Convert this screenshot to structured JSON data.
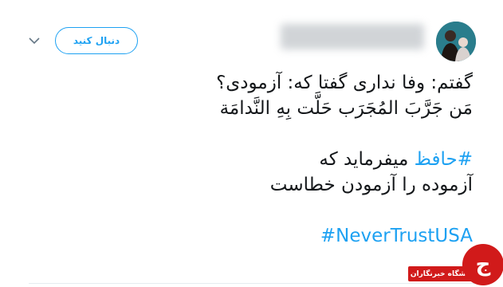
{
  "header": {
    "follow_label": "دنبال کنید"
  },
  "tweet": {
    "line1": "گفتم: وفا نداری گفتا که: آزمودی؟",
    "line2": "مَن جَرَّبَ المُجَرَب حَلَّت بِهِ النَّدامَة",
    "line3_hashtag": "#حافظ",
    "line3_rest": " میفرماید که",
    "line4": "آزموده را آزمودن خطاست",
    "hashtag_en": "#NeverTrustUSA"
  },
  "watermark": {
    "text": "باشگاه خبرنگاران",
    "logo_letter": "ج"
  },
  "icons": {
    "caret": "chevron-down-icon",
    "avatar": "avatar"
  },
  "colors": {
    "accent": "#1da1f2",
    "text": "#14171a",
    "watermark": "#d11a1a"
  }
}
